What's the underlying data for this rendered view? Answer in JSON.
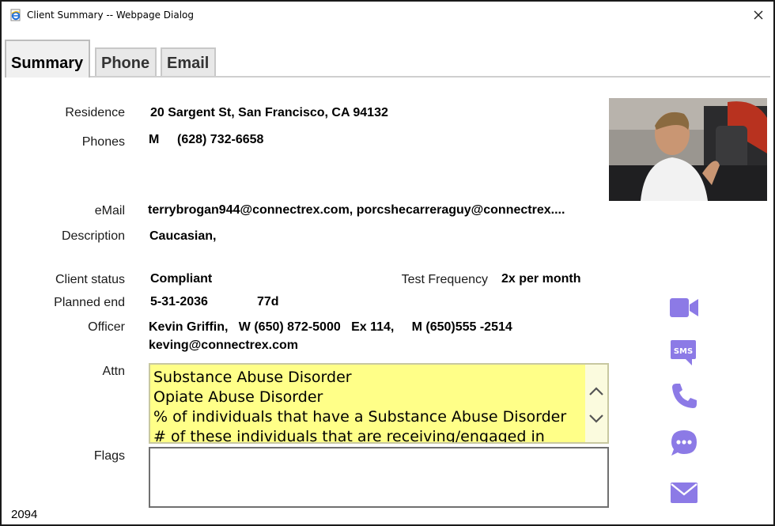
{
  "window": {
    "title": "Client Summary -- Webpage Dialog"
  },
  "tabs": [
    {
      "label": "Summary",
      "active": true
    },
    {
      "label": "Phone",
      "active": false
    },
    {
      "label": "Email",
      "active": false
    }
  ],
  "fields": {
    "residence": {
      "label": "Residence",
      "value": "20 Sargent St, San Francisco, CA 94132"
    },
    "phones": {
      "label": "Phones",
      "type": "M",
      "number": "(628) 732-6658"
    },
    "email": {
      "label": "eMail",
      "value": "terrybrogan944@connectrex.com, porcshecarreraguy@connectrex...."
    },
    "description": {
      "label": "Description",
      "value": "Caucasian,"
    },
    "client_status": {
      "label": "Client status",
      "value": "Compliant"
    },
    "test_frequency": {
      "label": "Test Frequency",
      "value": "2x per month"
    },
    "planned_end": {
      "label": "Planned end",
      "date": "5-31-2036",
      "remaining": "77d"
    },
    "officer": {
      "label": "Officer",
      "line1": "Kevin Griffin,   W (650) 872-5000   Ex 114,     M (650)555 -2514",
      "line2": "keving@connectrex.com"
    },
    "attn": {
      "label": "Attn",
      "lines": [
        "Substance Abuse Disorder",
        "Opiate Abuse Disorder",
        "% of individuals that have a Substance Abuse Disorder",
        "# of these individuals that are receiving/engaged in"
      ]
    },
    "flags": {
      "label": "Flags",
      "value": ""
    }
  },
  "footer": {
    "id": "2094"
  },
  "icons": {
    "video": "video-camera-icon",
    "sms": "sms-icon",
    "phone": "phone-icon",
    "chat": "chat-bubble-icon",
    "email": "envelope-icon",
    "accent_color": "#8c7ae6"
  }
}
